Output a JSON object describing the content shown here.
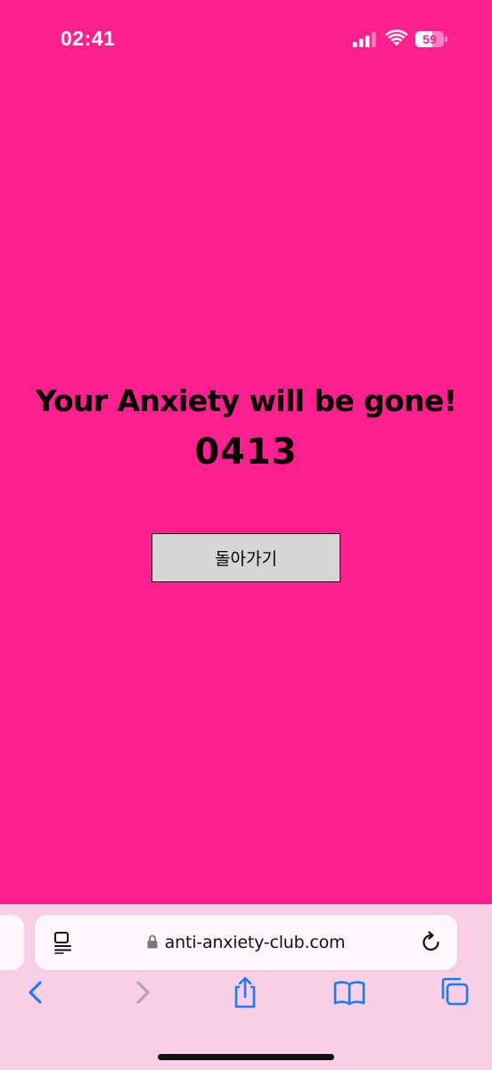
{
  "status_bar": {
    "time": "02:41",
    "battery_level": "59",
    "battery_fraction": 0.59
  },
  "main": {
    "headline": "Your Anxiety will be gone!",
    "code": "0413",
    "back_button_label": "돌아가기"
  },
  "browser": {
    "url": "anti-anxiety-club.com",
    "accent_color": "#1a7cf5",
    "page_background": "#ff1f8e",
    "icons": {
      "reader": "reader-mode-icon",
      "lock": "lock-icon",
      "reload": "reload-icon",
      "back": "chevron-left-icon",
      "forward": "chevron-right-icon",
      "share": "share-icon",
      "bookmarks": "book-icon",
      "tabs": "tabs-icon"
    }
  }
}
